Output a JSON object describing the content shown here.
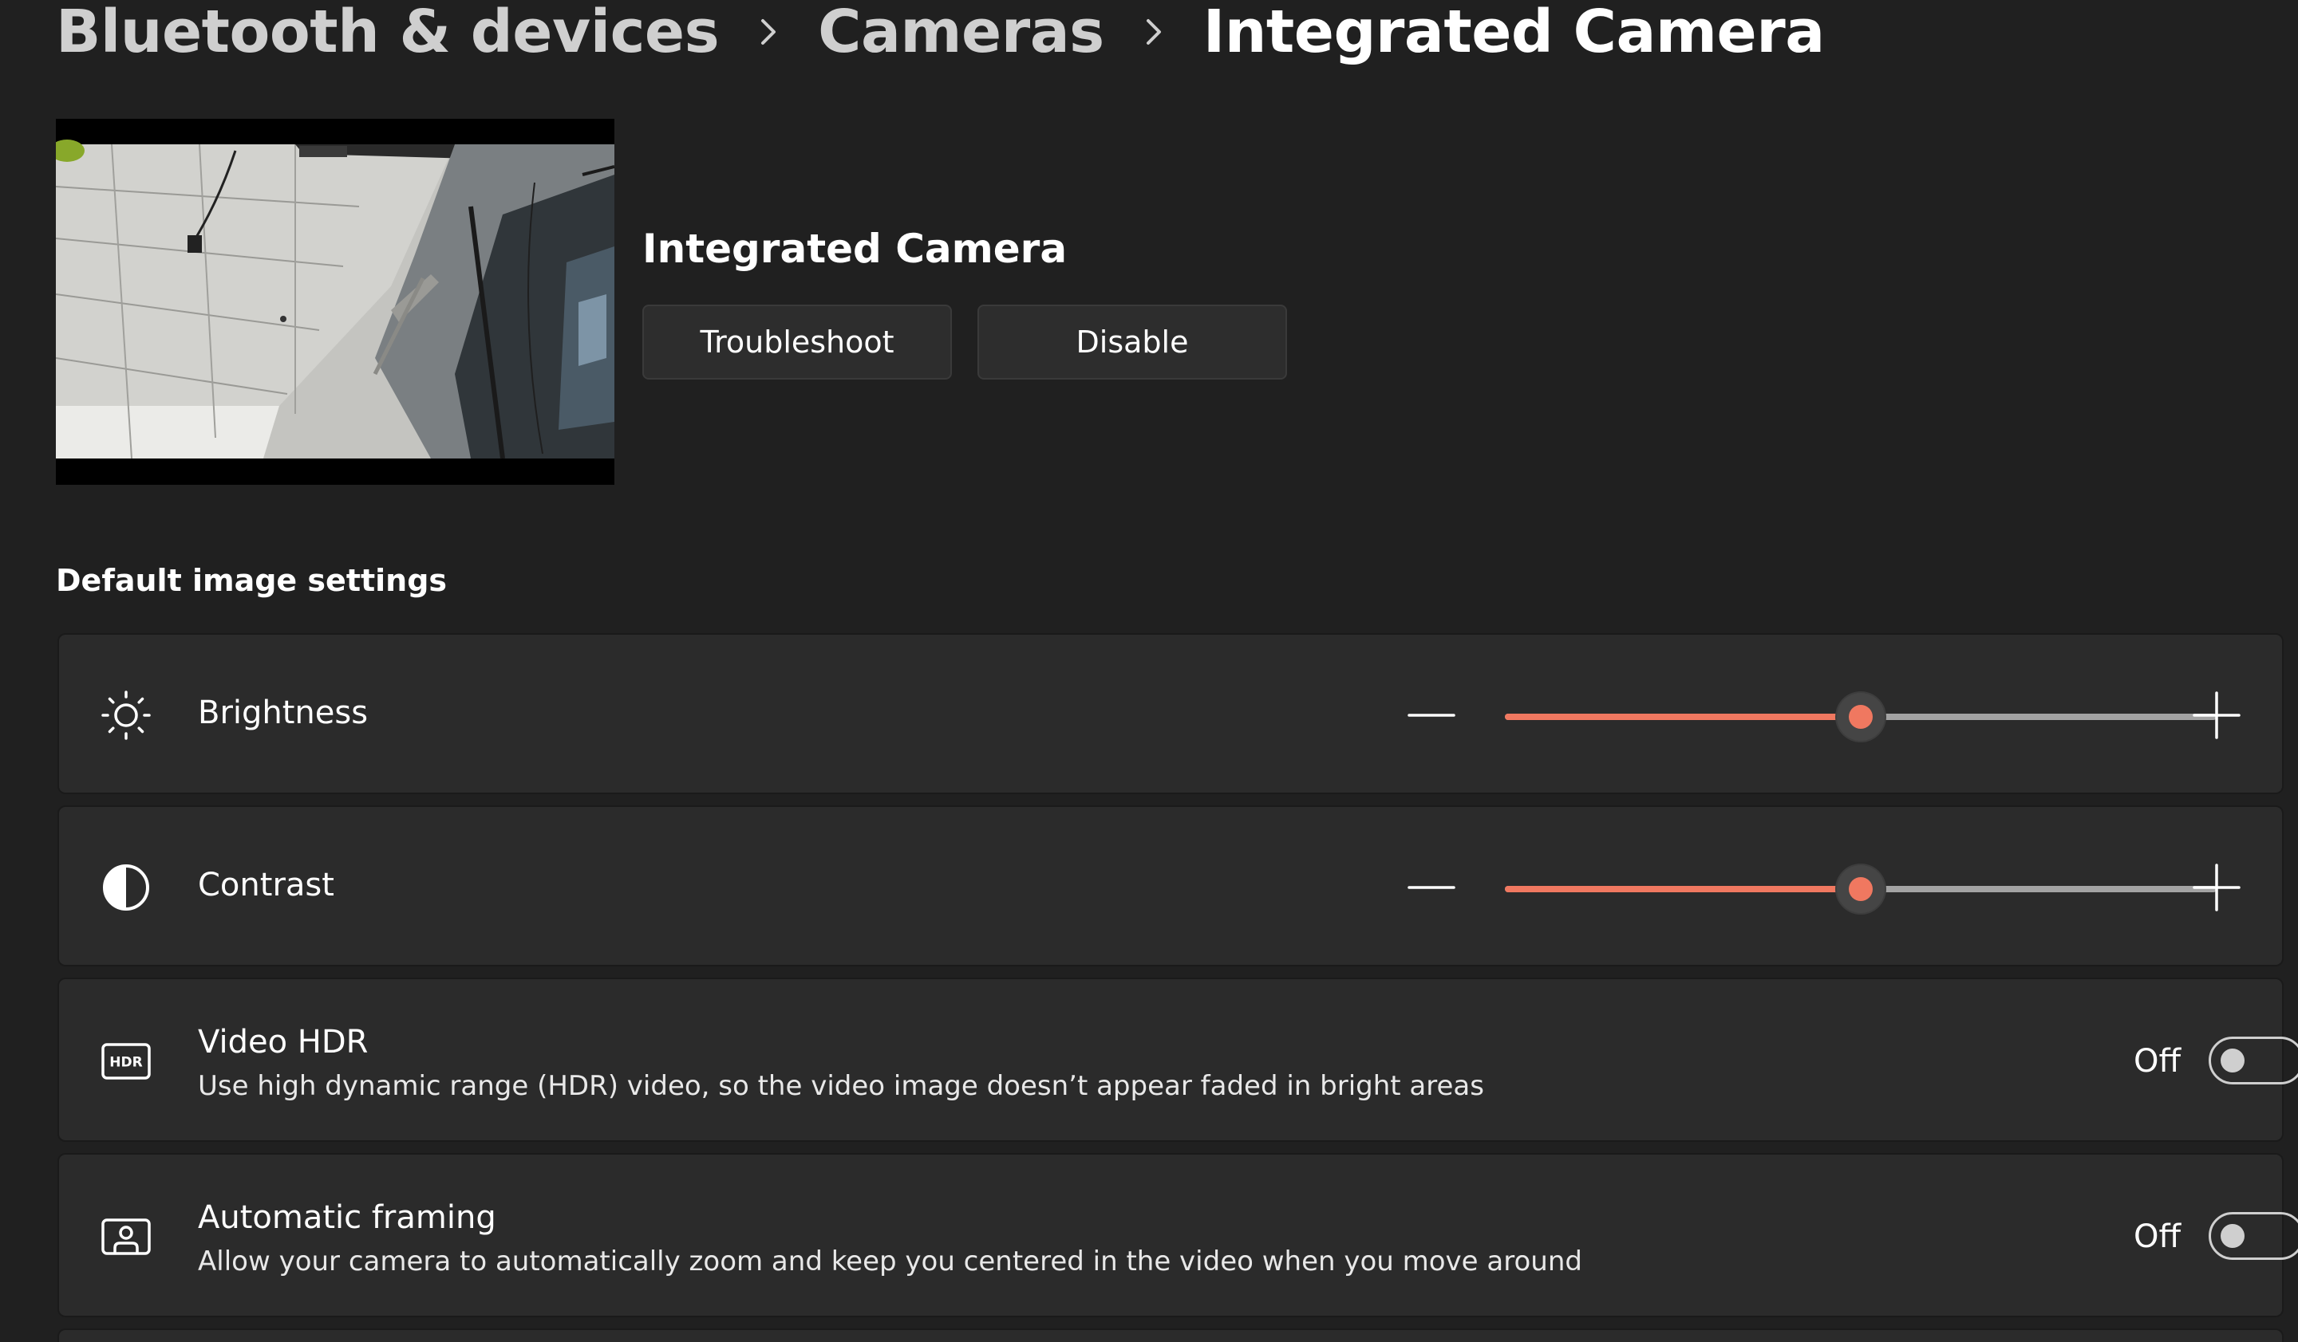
{
  "breadcrumb": {
    "items": [
      "Bluetooth & devices",
      "Cameras",
      "Integrated Camera"
    ],
    "separator_icon": "chevron-right-icon"
  },
  "camera": {
    "name": "Integrated Camera",
    "troubleshoot_label": "Troubleshoot",
    "disable_label": "Disable"
  },
  "section": {
    "title": "Default image settings"
  },
  "settings": {
    "brightness": {
      "label": "Brightness",
      "icon": "brightness-sun-icon",
      "value_fraction": 0.5
    },
    "contrast": {
      "label": "Contrast",
      "icon": "contrast-icon",
      "value_fraction": 0.5
    },
    "video_hdr": {
      "label": "Video HDR",
      "description": "Use high dynamic range (HDR) video, so the video image doesn’t appear faded in bright areas",
      "state": "Off",
      "icon": "hdr-icon"
    },
    "automatic_framing": {
      "label": "Automatic framing",
      "description": "Allow your camera to automatically zoom and keep you centered in the video when you move around",
      "state": "Off",
      "icon": "framing-portrait-icon"
    }
  },
  "colors": {
    "accent": "#f07860",
    "background": "#202020",
    "card": "#2b2b2b"
  }
}
